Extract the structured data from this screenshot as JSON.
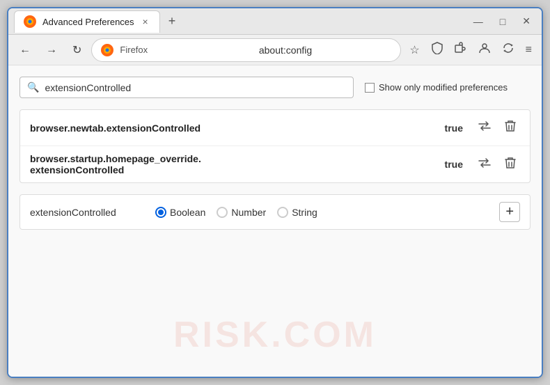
{
  "window": {
    "title": "Advanced Preferences",
    "tab_close": "×",
    "new_tab": "+",
    "win_minimize": "—",
    "win_maximize": "□",
    "win_close": "✕"
  },
  "nav": {
    "back": "←",
    "forward": "→",
    "reload": "↻",
    "browser_name": "Firefox",
    "url": "about:config",
    "bookmark_icon": "☆",
    "shield_icon": "🛡",
    "ext_icon": "🧩",
    "lock_icon": "🔒",
    "menu_icon": "≡"
  },
  "search": {
    "placeholder": "extensionControlled",
    "value": "extensionControlled",
    "show_modified_label": "Show only modified preferences"
  },
  "results": [
    {
      "name": "browser.newtab.extensionControlled",
      "value": "true"
    },
    {
      "name_line1": "browser.startup.homepage_override.",
      "name_line2": "extensionControlled",
      "value": "true"
    }
  ],
  "add_pref": {
    "name": "extensionControlled",
    "type_options": [
      {
        "label": "Boolean",
        "selected": true
      },
      {
        "label": "Number",
        "selected": false
      },
      {
        "label": "String",
        "selected": false
      }
    ],
    "add_label": "+"
  },
  "watermark": "RISK.COM",
  "icons": {
    "search": "🔍",
    "toggle": "⇄",
    "delete": "🗑",
    "add": "+"
  }
}
